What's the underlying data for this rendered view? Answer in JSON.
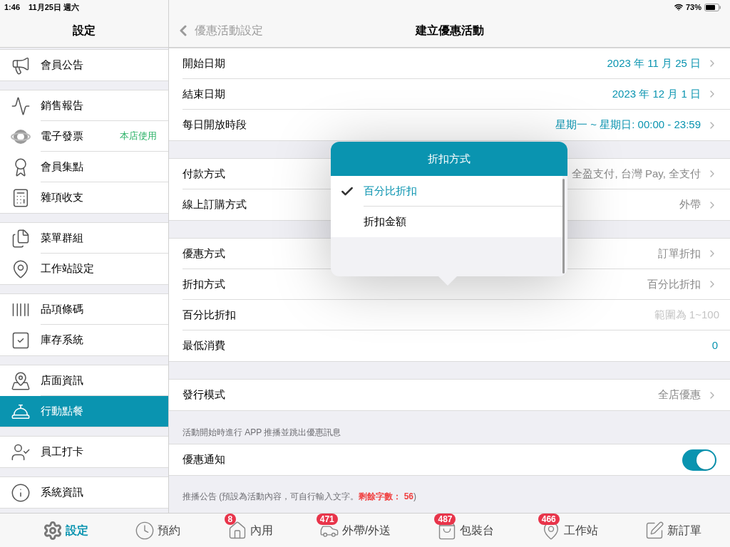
{
  "status_bar": {
    "time": "1:46",
    "date": "11月25日 週六",
    "battery": "73%"
  },
  "sidebar": {
    "title": "設定",
    "groups": [
      [
        {
          "label": "會員公告",
          "selected": false
        }
      ],
      [
        {
          "label": "銷售報告",
          "selected": false
        },
        {
          "label": "電子發票",
          "selected": false,
          "badge": "本店使用"
        },
        {
          "label": "會員集點",
          "selected": false
        },
        {
          "label": "雜項收支",
          "selected": false
        }
      ],
      [
        {
          "label": "菜單群組",
          "selected": false
        },
        {
          "label": "工作站設定",
          "selected": false
        }
      ],
      [
        {
          "label": "品項條碼",
          "selected": false
        },
        {
          "label": "庫存系統",
          "selected": false
        }
      ],
      [
        {
          "label": "店面資訊",
          "selected": false
        },
        {
          "label": "行動點餐",
          "selected": true
        }
      ],
      [
        {
          "label": "員工打卡",
          "selected": false
        }
      ],
      [
        {
          "label": "系統資訊",
          "selected": false
        }
      ]
    ]
  },
  "nav": {
    "back": "優惠活動設定",
    "title": "建立優惠活動"
  },
  "sections": [
    {
      "rows": [
        {
          "kind": "value",
          "label": "開始日期",
          "value": "2023 年 11 月 25 日",
          "accent": true,
          "chevron": true
        },
        {
          "kind": "value",
          "label": "結束日期",
          "value": "2023 年 12 月 1 日",
          "accent": true,
          "chevron": true
        },
        {
          "kind": "value",
          "label": "每日開放時段",
          "value": "星期一 ~ 星期日: 00:00 - 23:59",
          "accent": true,
          "chevron": true
        }
      ]
    },
    {
      "rows": [
        {
          "kind": "value",
          "label": "付款方式",
          "value": "全盈支付, 台灣 Pay, 全支付",
          "accent": false,
          "chevron": true
        },
        {
          "kind": "value",
          "label": "線上訂購方式",
          "value": "外帶",
          "accent": false,
          "chevron": true
        }
      ]
    },
    {
      "rows": [
        {
          "kind": "value",
          "label": "優惠方式",
          "value": "訂單折扣",
          "accent": false,
          "chevron": true
        },
        {
          "kind": "value",
          "label": "折扣方式",
          "value": "百分比折扣",
          "accent": false,
          "chevron": true
        },
        {
          "kind": "input",
          "label": "百分比折扣",
          "placeholder": "範圍為 1~100"
        },
        {
          "kind": "value",
          "label": "最低消費",
          "value": "0",
          "accent": true,
          "chevron": false
        }
      ]
    },
    {
      "rows": [
        {
          "kind": "value",
          "label": "發行模式",
          "value": "全店優惠",
          "accent": false,
          "chevron": true
        }
      ]
    },
    {
      "caption": "活動開始時進行 APP 推播並跳出優惠訊息",
      "rows": [
        {
          "kind": "toggle",
          "label": "優惠通知",
          "on": true
        }
      ]
    },
    {
      "note": {
        "text": "推播公告 (預設為活動內容，可自行輸入文字。",
        "remaining_label": "剩餘字數：",
        "remaining": "56",
        "end": ")"
      }
    }
  ],
  "popover": {
    "title": "折扣方式",
    "options": [
      {
        "label": "百分比折扣",
        "selected": true
      },
      {
        "label": "折扣金額",
        "selected": false
      }
    ]
  },
  "tab_bar": [
    {
      "label": "設定",
      "selected": true
    },
    {
      "label": "預約",
      "selected": false
    },
    {
      "label": "內用",
      "selected": false,
      "badge": "8"
    },
    {
      "label": "外帶/外送",
      "selected": false,
      "badge": "471"
    },
    {
      "label": "包裝台",
      "selected": false,
      "badge": "487"
    },
    {
      "label": "工作站",
      "selected": false,
      "badge": "466"
    },
    {
      "label": "新訂單",
      "selected": false
    }
  ]
}
